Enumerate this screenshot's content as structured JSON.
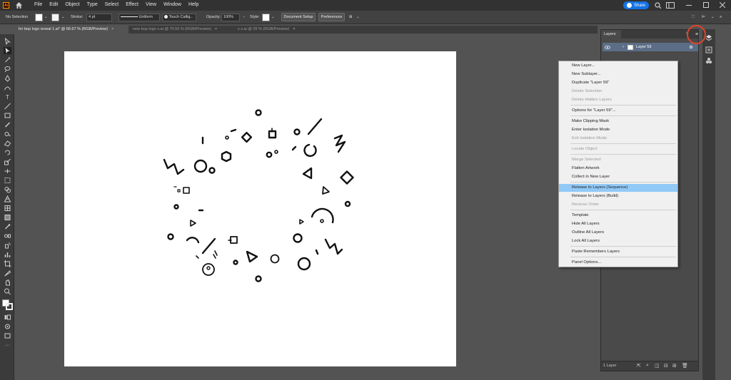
{
  "menubar": {
    "app_logo": "Ai",
    "items": [
      "File",
      "Edit",
      "Object",
      "Type",
      "Select",
      "Effect",
      "View",
      "Window",
      "Help"
    ],
    "share_label": "Share"
  },
  "controlbar": {
    "selection_label": "No Selection",
    "stroke_label": "Stroke:",
    "stroke_value": "4 pt",
    "uniform_label": "Uniform",
    "brush_label": "Touch Callig...",
    "opacity_label": "Opacity:",
    "opacity_value": "100%",
    "style_label": "Style:",
    "document_setup": "Document Setup",
    "preferences": "Preferences"
  },
  "tabs": [
    {
      "label": "for bop logo reveal 1.ai* @ 66.67 % (RGB/Preview)",
      "active": true
    },
    {
      "label": "new bop logo x.ai @ 70.59 % (RGB/Preview)",
      "active": false
    },
    {
      "label": "z x.ai @ 25 % (RGB/Preview)",
      "active": false
    }
  ],
  "layers_panel": {
    "tab_label": "Layers",
    "layer_name": "Layer 59",
    "footer_count": "1 Layer"
  },
  "context_menu": {
    "items": [
      {
        "label": "New Layer...",
        "enabled": true
      },
      {
        "label": "New Sublayer...",
        "enabled": true
      },
      {
        "label": "Duplicate \"Layer 59\"",
        "enabled": true
      },
      {
        "label": "Delete Selection",
        "enabled": false
      },
      {
        "label": "Delete Hidden Layers",
        "enabled": false
      },
      {
        "label": "Options for \"Layer 59\"...",
        "enabled": true
      },
      {
        "label": "Make Clipping Mask",
        "enabled": true
      },
      {
        "label": "Enter Isolation Mode",
        "enabled": true
      },
      {
        "label": "Exit Isolation Mode",
        "enabled": false
      },
      {
        "label": "Locate Object",
        "enabled": false
      },
      {
        "label": "Merge Selected",
        "enabled": false
      },
      {
        "label": "Flatten Artwork",
        "enabled": true
      },
      {
        "label": "Collect in New Layer",
        "enabled": true
      },
      {
        "label": "Release to Layers (Sequence)",
        "enabled": true,
        "highlighted": true
      },
      {
        "label": "Release to Layers (Build)",
        "enabled": true
      },
      {
        "label": "Reverse Order",
        "enabled": false
      },
      {
        "label": "Template",
        "enabled": true
      },
      {
        "label": "Hide All Layers",
        "enabled": true
      },
      {
        "label": "Outline All Layers",
        "enabled": true
      },
      {
        "label": "Lock All Layers",
        "enabled": true
      },
      {
        "label": "Paste Remembers Layers",
        "enabled": true
      },
      {
        "label": "Panel Options...",
        "enabled": true
      }
    ]
  },
  "colors": {
    "accent": "#1473e6",
    "highlight": "#91c9f7",
    "annotation_ring": "#e0452b"
  }
}
